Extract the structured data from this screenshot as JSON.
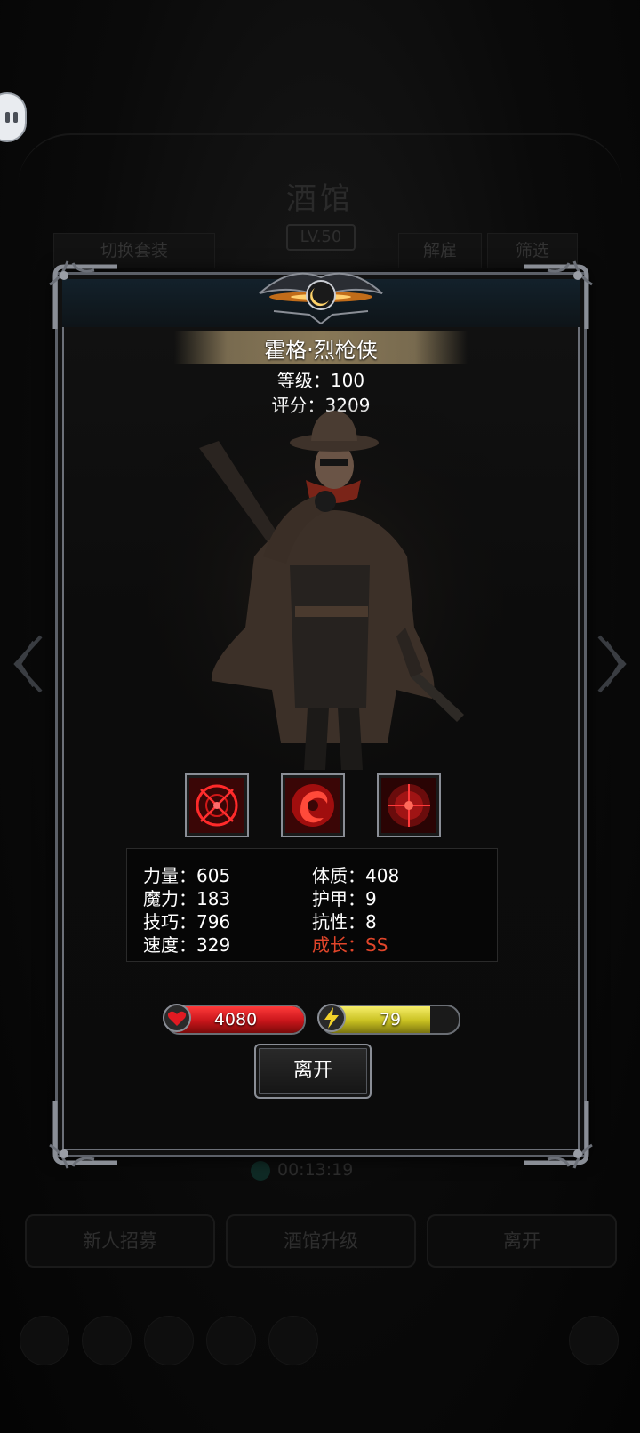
{
  "background": {
    "title": "酒馆",
    "level": "LV.50",
    "tab_switch_outfit": "切换套装",
    "tab_dismiss": "解雇",
    "tab_filter": "筛选",
    "timer": "00:13:19",
    "btn_recruit": "新人招募",
    "btn_upgrade": "酒馆升级",
    "btn_leave": "离开"
  },
  "hero": {
    "name": "霍格·烈枪侠",
    "level": "等级：100",
    "score": "评分：3209"
  },
  "skills": [
    {
      "icon": "crosshair-rune-icon"
    },
    {
      "icon": "red-swirl-icon"
    },
    {
      "icon": "red-target-icon"
    }
  ],
  "stats": {
    "strength": "力量：605",
    "magic": "魔力：183",
    "skill": "技巧：796",
    "speed": "速度：329",
    "constitution": "体质：408",
    "armor": "护甲：9",
    "resist": "抗性：8",
    "growth": "成长：SS"
  },
  "bars": {
    "hp_value": "4080",
    "hp_fill": 1.0,
    "energy_value": "79",
    "energy_fill": 0.79
  },
  "buttons": {
    "leave": "离开"
  },
  "colors": {
    "growth": "#e0452a",
    "hp": "#c8151a",
    "energy": "#c8c020"
  }
}
